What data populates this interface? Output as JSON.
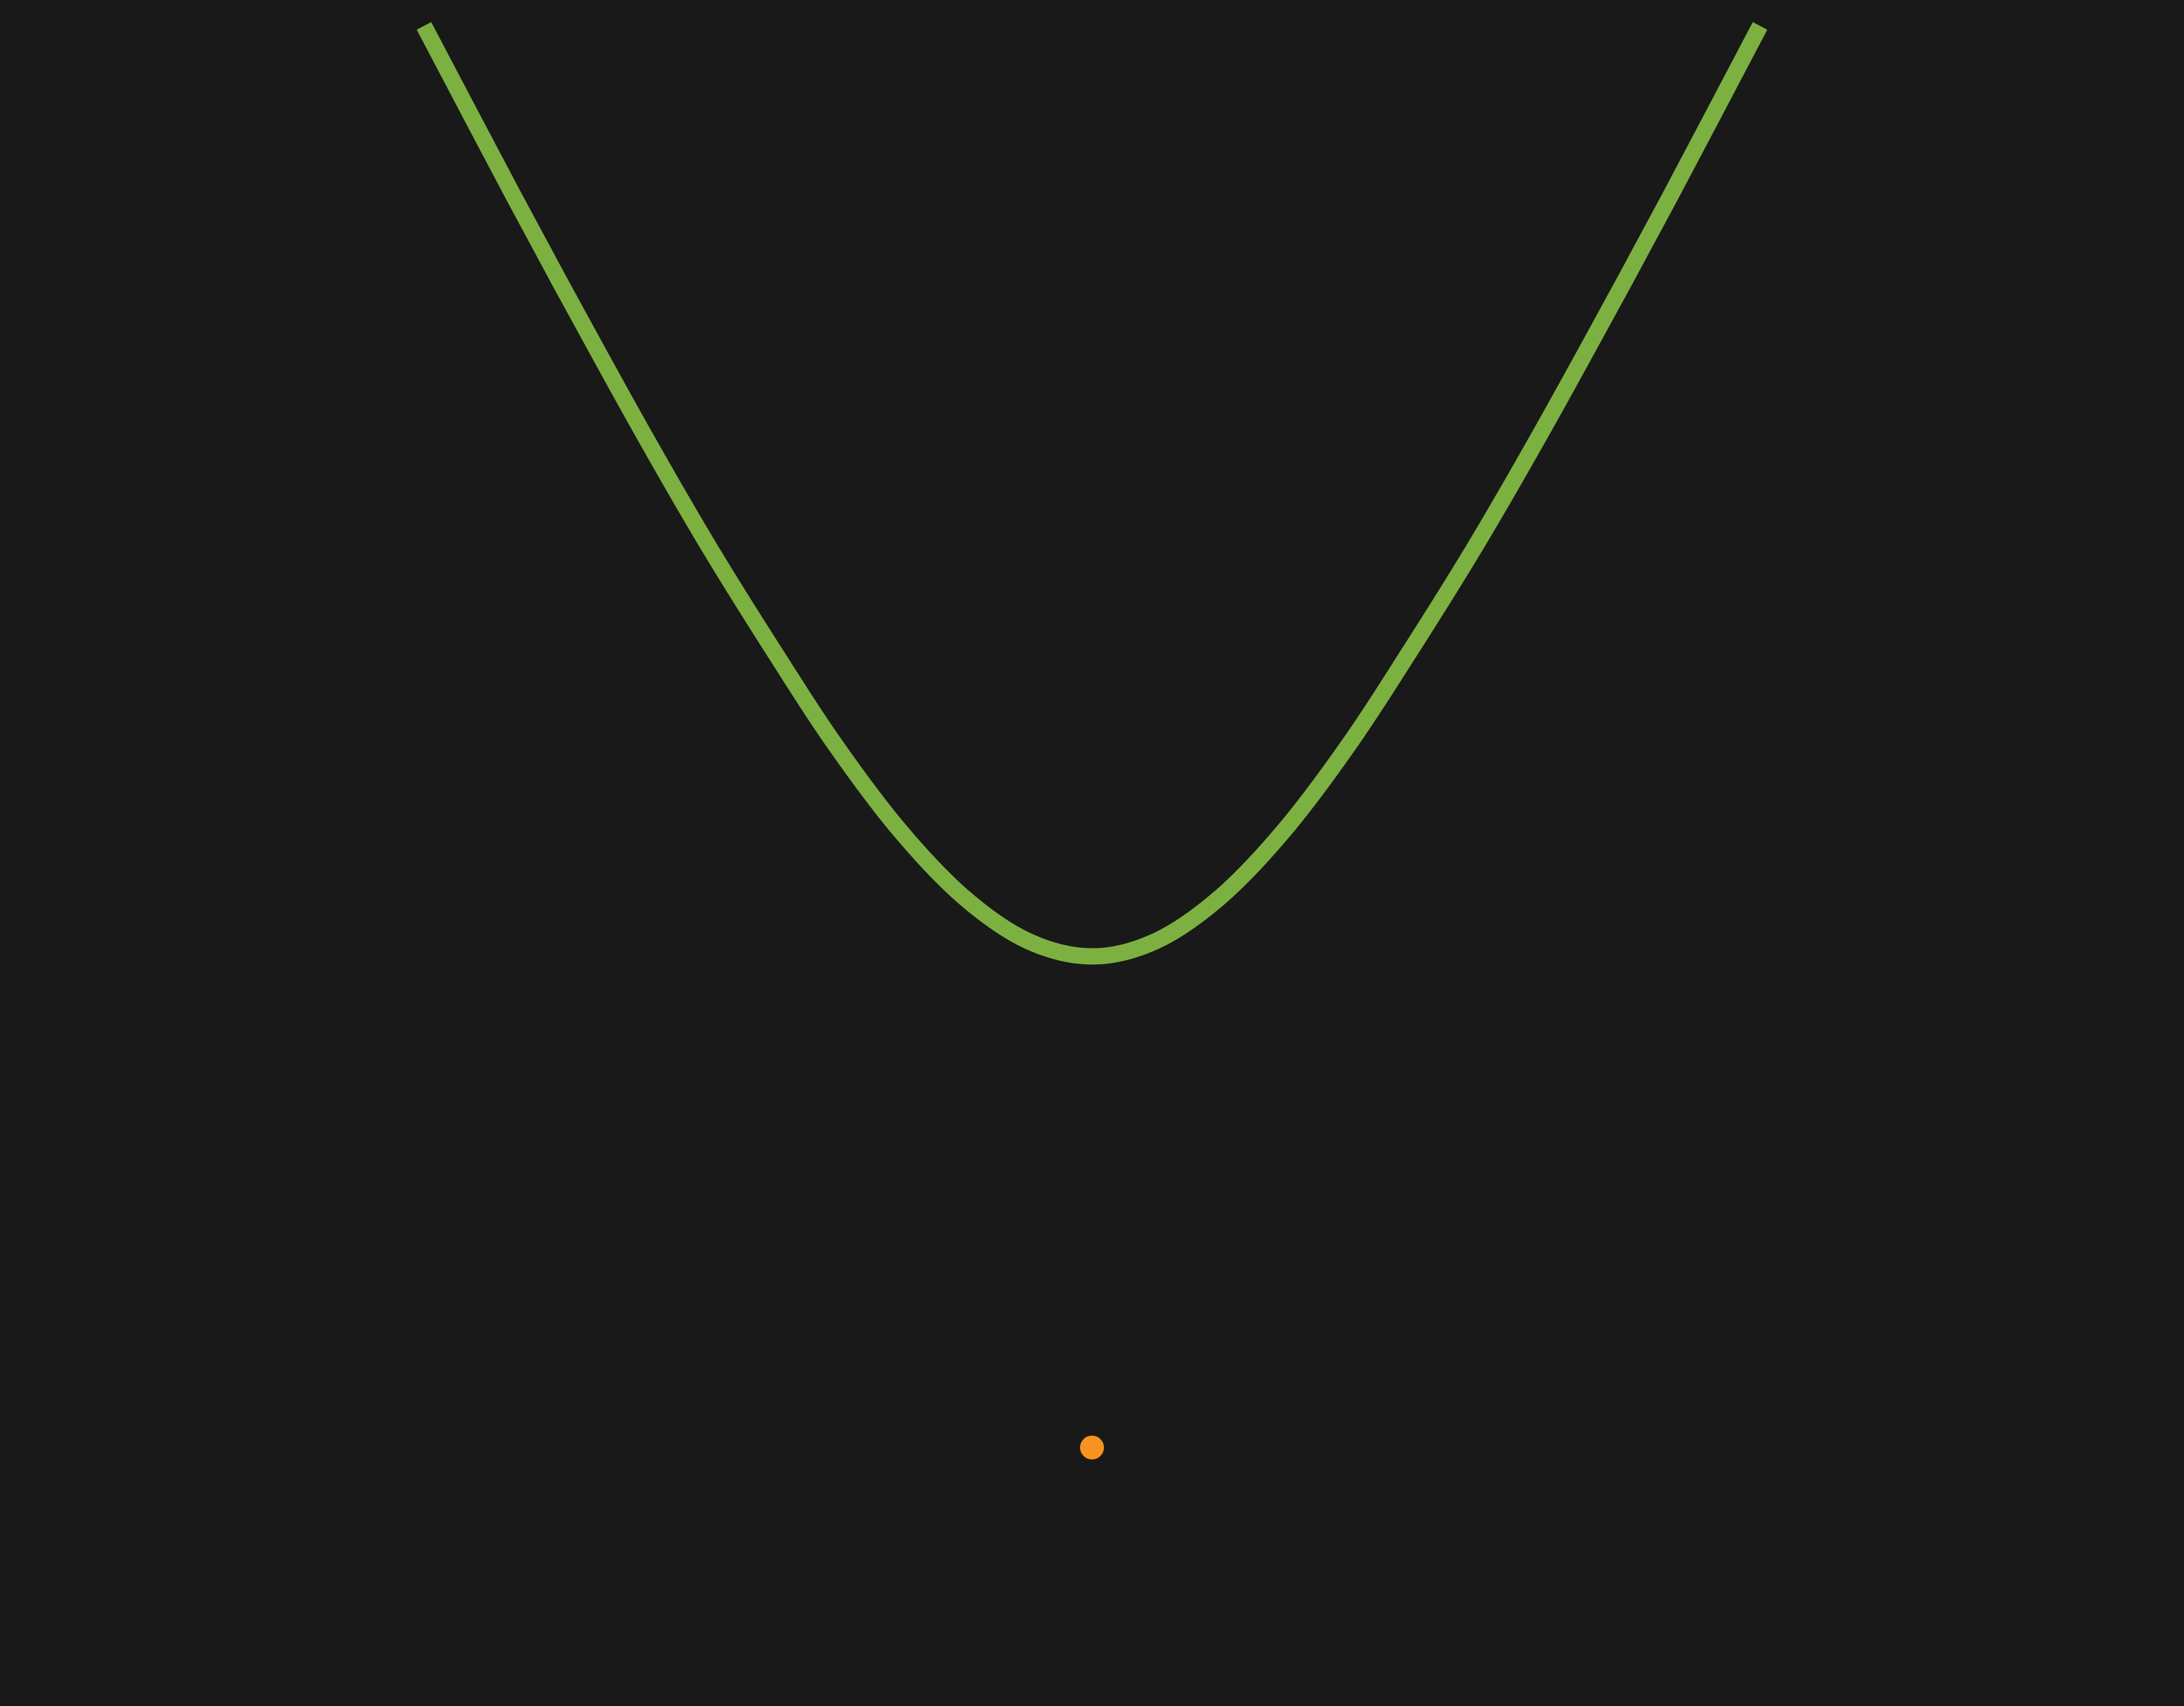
{
  "colors": {
    "background": "#191919",
    "curve": "#7cb142",
    "point": "#f7931e",
    "point_outline": "#1a1a1a"
  },
  "chart_data": {
    "type": "line",
    "title": "",
    "xlabel": "",
    "ylabel": "",
    "grid": false,
    "axes_visible": false,
    "xlim": [
      -3.4,
      3.4
    ],
    "ylim": [
      -3.0,
      3.6
    ],
    "series": [
      {
        "x": [
          -2.08,
          -1.8,
          -1.6,
          -1.4,
          -1.2,
          -1.0,
          -0.8,
          -0.6,
          -0.4,
          -0.2,
          0.0,
          0.2,
          0.4,
          0.6,
          0.8,
          1.0,
          1.2,
          1.4,
          1.6,
          1.8,
          2.08
        ],
        "y": [
          3.5,
          2.84,
          2.38,
          1.93,
          1.5,
          1.1,
          0.72,
          0.39,
          0.13,
          -0.04,
          -0.1,
          -0.04,
          0.13,
          0.39,
          0.72,
          1.1,
          1.5,
          1.93,
          2.38,
          2.84,
          3.5
        ]
      },
      {
        "type": "scatter",
        "x": [
          0.0
        ],
        "y": [
          -2.0
        ]
      }
    ]
  }
}
